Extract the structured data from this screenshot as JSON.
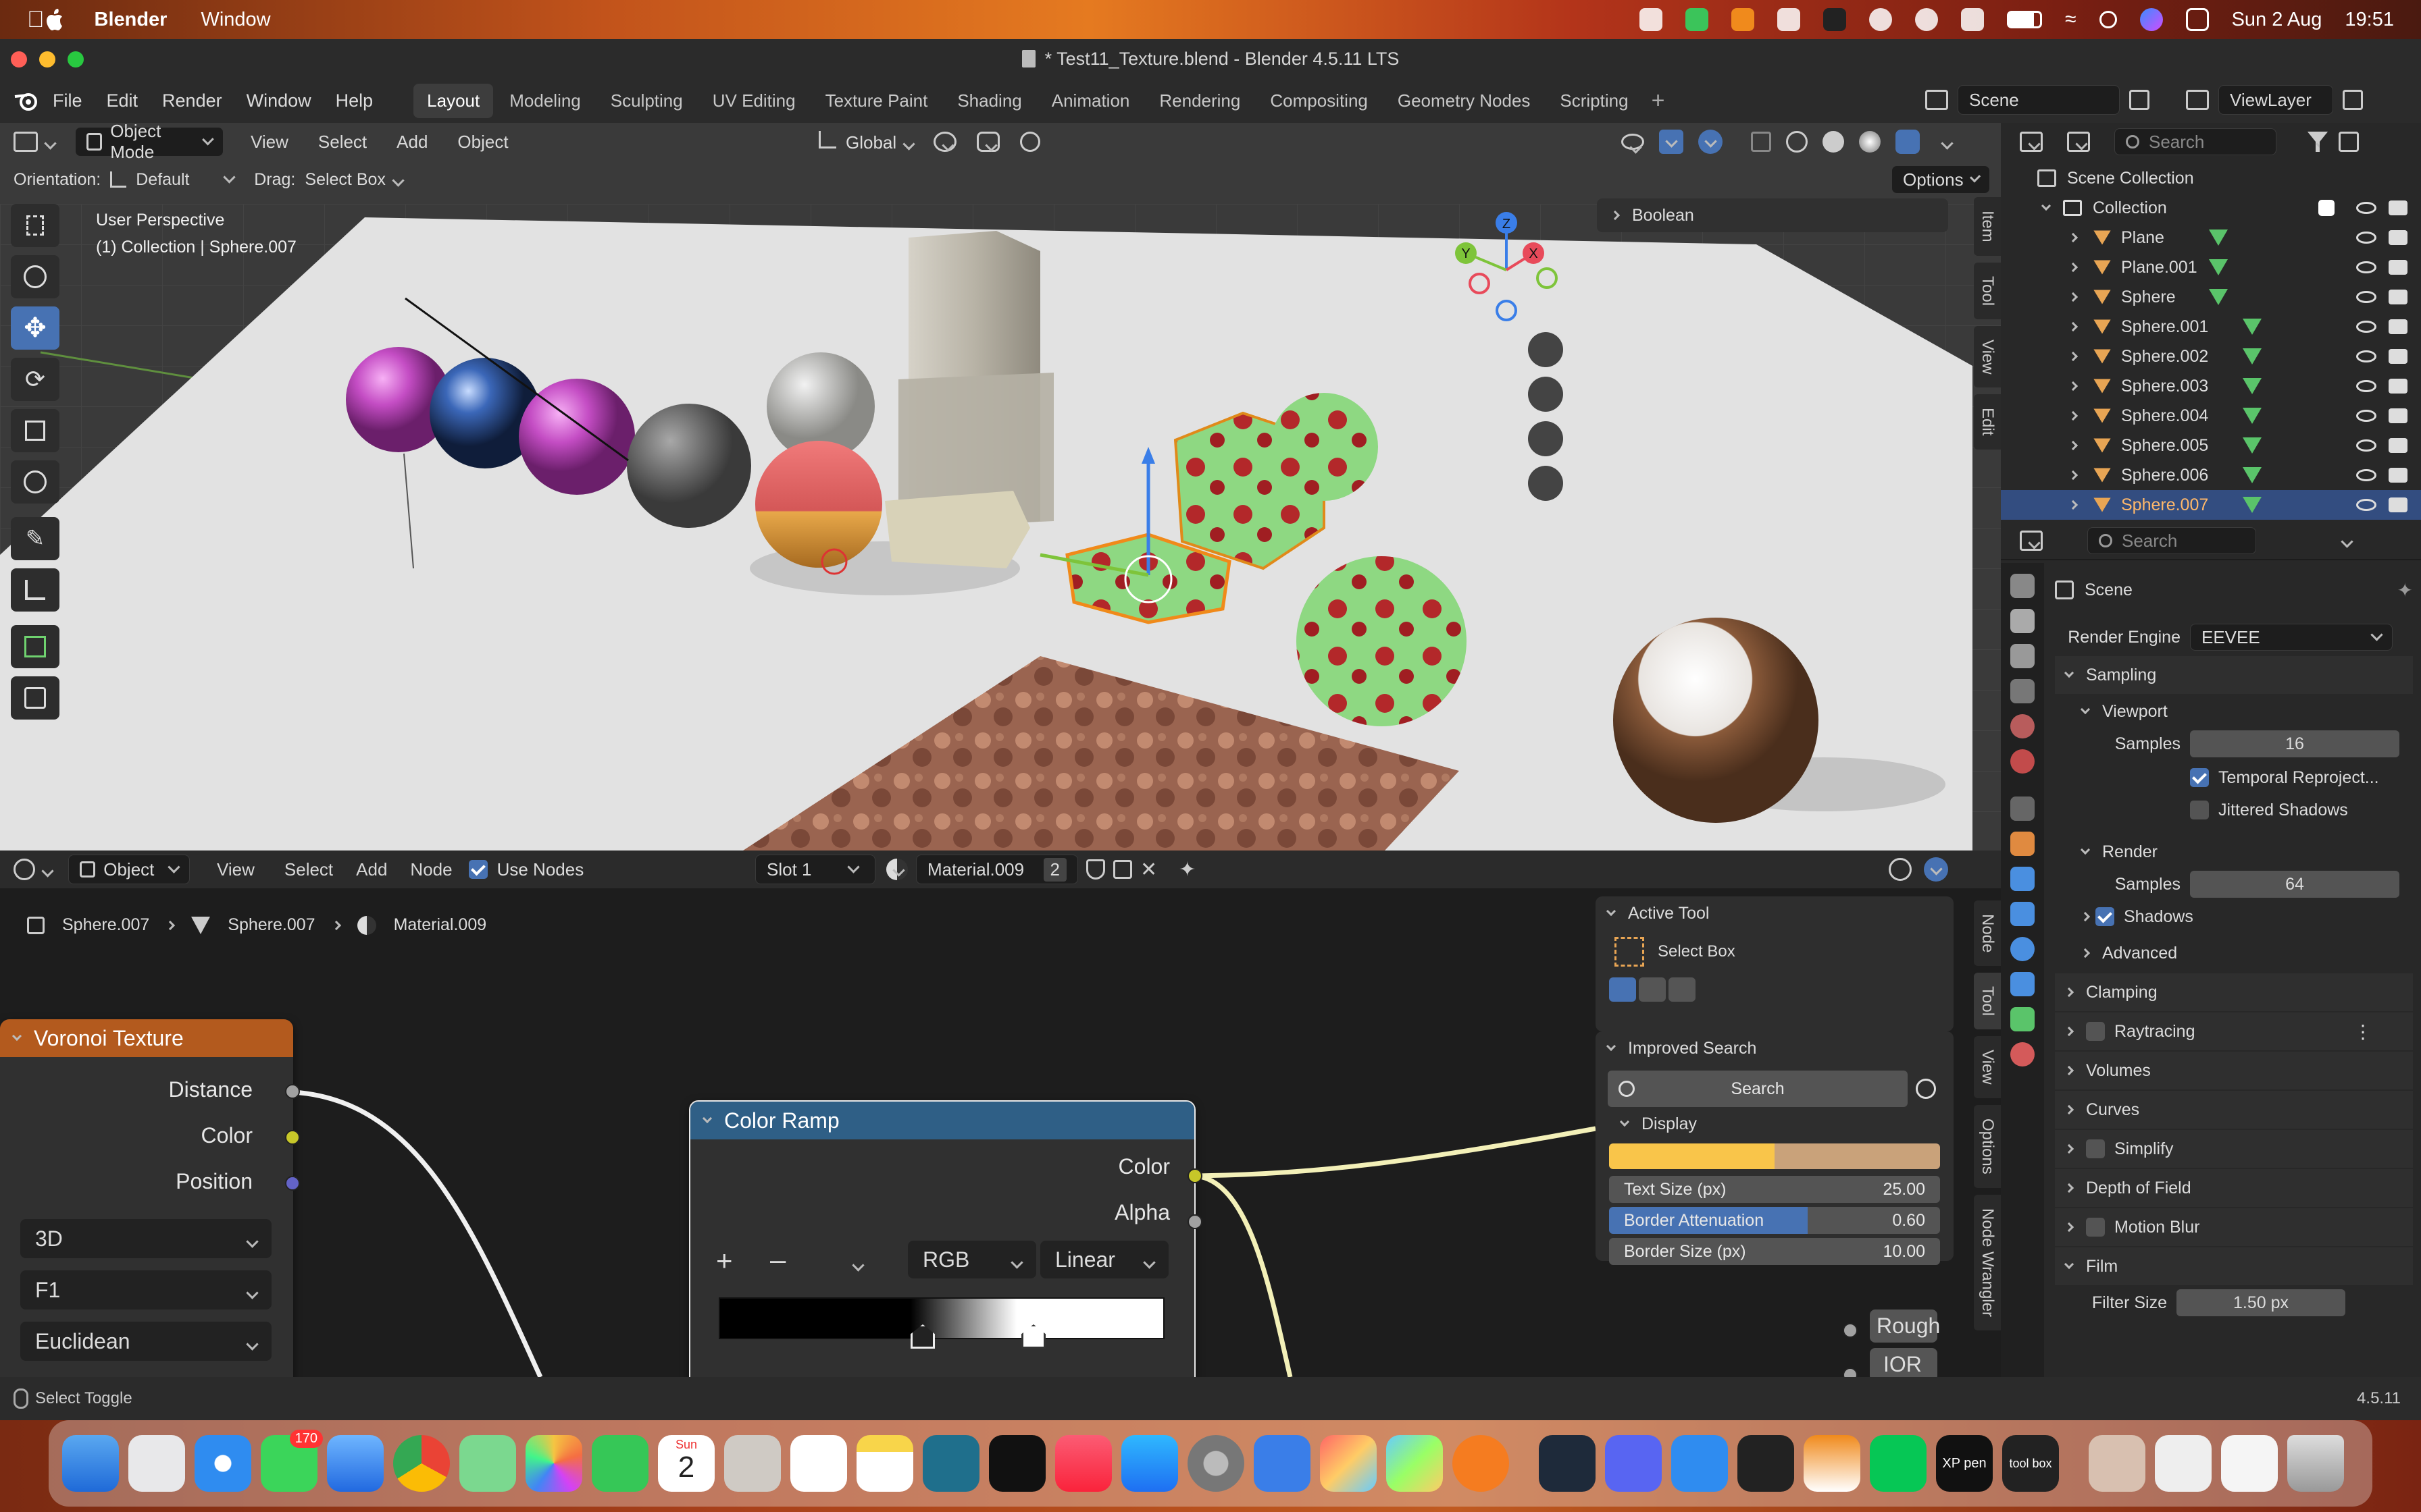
{
  "macbar": {
    "app": "Blender",
    "menus": [
      "Window"
    ],
    "date": "Sun 2 Aug",
    "time": "19:51"
  },
  "titlebar": {
    "title": "* Test11_Texture.blend - Blender 4.5.11 LTS"
  },
  "topmenu": {
    "items": [
      "File",
      "Edit",
      "Render",
      "Window",
      "Help"
    ],
    "workspaces": [
      "Layout",
      "Modeling",
      "Sculpting",
      "UV Editing",
      "Texture Paint",
      "Shading",
      "Animation",
      "Rendering",
      "Compositing",
      "Geometry Nodes",
      "Scripting"
    ],
    "scene": "Scene",
    "view_layer": "ViewLayer"
  },
  "viewport": {
    "mode": "Object Mode",
    "menus": [
      "View",
      "Select",
      "Add",
      "Object"
    ],
    "orientation_label": "Orientation:",
    "orientation": "Default",
    "drag_label": "Drag:",
    "drag": "Select Box",
    "transform": "Global",
    "options": "Options",
    "perspective": "User Perspective",
    "context": "(1) Collection | Sphere.007",
    "panel": "Boolean",
    "tabs": [
      "Item",
      "Tool",
      "View",
      "Edit"
    ],
    "gizmo": {
      "z": "Z",
      "y": "Y",
      "x": "X"
    }
  },
  "nodeeditor": {
    "mode": "Object",
    "menus": [
      "View",
      "Select",
      "Add",
      "Node"
    ],
    "use_nodes": "Use Nodes",
    "slot": "Slot 1",
    "material": "Material.009",
    "users": "2",
    "breadcrumb": [
      "Sphere.007",
      "Sphere.007",
      "Material.009"
    ],
    "voronoi": {
      "title": "Voronoi Texture",
      "outputs": [
        "Distance",
        "Color",
        "Position"
      ],
      "dims": "3D",
      "feature": "F1",
      "metric": "Euclidean"
    },
    "colorramp": {
      "title": "Color Ramp",
      "outputs": [
        "Color",
        "Alpha"
      ],
      "mode": "RGB",
      "interp": "Linear"
    },
    "tabs": [
      "Node",
      "Tool",
      "View",
      "Options",
      "Node Wrangler"
    ],
    "partial": [
      "Rough",
      "IOR"
    ],
    "active_tool": {
      "title": "Active Tool",
      "tool": "Select Box"
    },
    "improved_search": {
      "title": "Improved Search",
      "search": "Search",
      "display": "Display",
      "text_size_label": "Text Size (px)",
      "text_size": "25.00",
      "border_att_label": "Border Attenuation",
      "border_att": "0.60",
      "border_size_label": "Border Size (px)",
      "border_size": "10.00"
    }
  },
  "outliner": {
    "search": "Search",
    "root": "Scene Collection",
    "collection": "Collection",
    "items": [
      "Plane",
      "Plane.001",
      "Sphere",
      "Sphere.001",
      "Sphere.002",
      "Sphere.003",
      "Sphere.004",
      "Sphere.005",
      "Sphere.006",
      "Sphere.007"
    ]
  },
  "properties": {
    "search": "Search",
    "context": "Scene",
    "render_engine_label": "Render Engine",
    "render_engine": "EEVEE",
    "sampling": "Sampling",
    "viewport": "Viewport",
    "samples_label": "Samples",
    "viewport_samples": "16",
    "temporal": "Temporal Reproject...",
    "jittered": "Jittered Shadows",
    "render": "Render",
    "render_samples": "64",
    "shadows": "Shadows",
    "advanced": "Advanced",
    "sections": [
      "Clamping",
      "Raytracing",
      "Volumes",
      "Curves",
      "Simplify",
      "Depth of Field",
      "Motion Blur",
      "Film"
    ],
    "filter_size_label": "Filter Size",
    "filter_size": "1.50 px"
  },
  "status": {
    "left": "Select Toggle",
    "version": "4.5.11"
  },
  "dock": {
    "calendar_month": "Sun",
    "calendar_day": "2",
    "messages_badge": "170",
    "xp_label": "XP pen",
    "toolbox_label": "tool box"
  },
  "colors": {
    "accent": "#4772b3",
    "voronoi_header": "#b35a1e",
    "colorramp_header": "#2f5f86",
    "orange": "#e8a554"
  }
}
